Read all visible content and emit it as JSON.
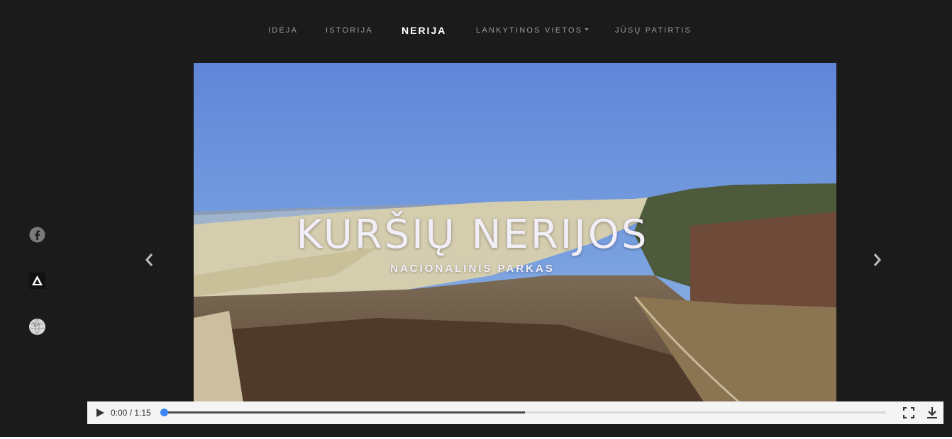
{
  "nav": {
    "items": [
      {
        "label": "Idėja",
        "active": false
      },
      {
        "label": "Istorija",
        "active": false
      },
      {
        "label": "Nerija",
        "active": true
      },
      {
        "label": "Lankytinos vietos",
        "active": false,
        "has_dropdown": true
      },
      {
        "label": "Jūsų patirtis",
        "active": false
      }
    ]
  },
  "social": [
    {
      "icon": "facebook-icon"
    },
    {
      "icon": "camping-tent-icon"
    },
    {
      "icon": "wikipedia-globe-icon"
    }
  ],
  "hero": {
    "title": "KURŠIŲ NERIJOS",
    "subtitle": "NACIONALINIS PARKAS"
  },
  "player": {
    "time": "0:00 / 1:15",
    "progress_fraction": 0.0,
    "buffered_fraction": 0.5
  },
  "colors": {
    "background": "#1b1b1b",
    "nav_text": "#9a9a9a",
    "nav_active": "#ffffff",
    "progress_accent": "#3a86f5"
  }
}
